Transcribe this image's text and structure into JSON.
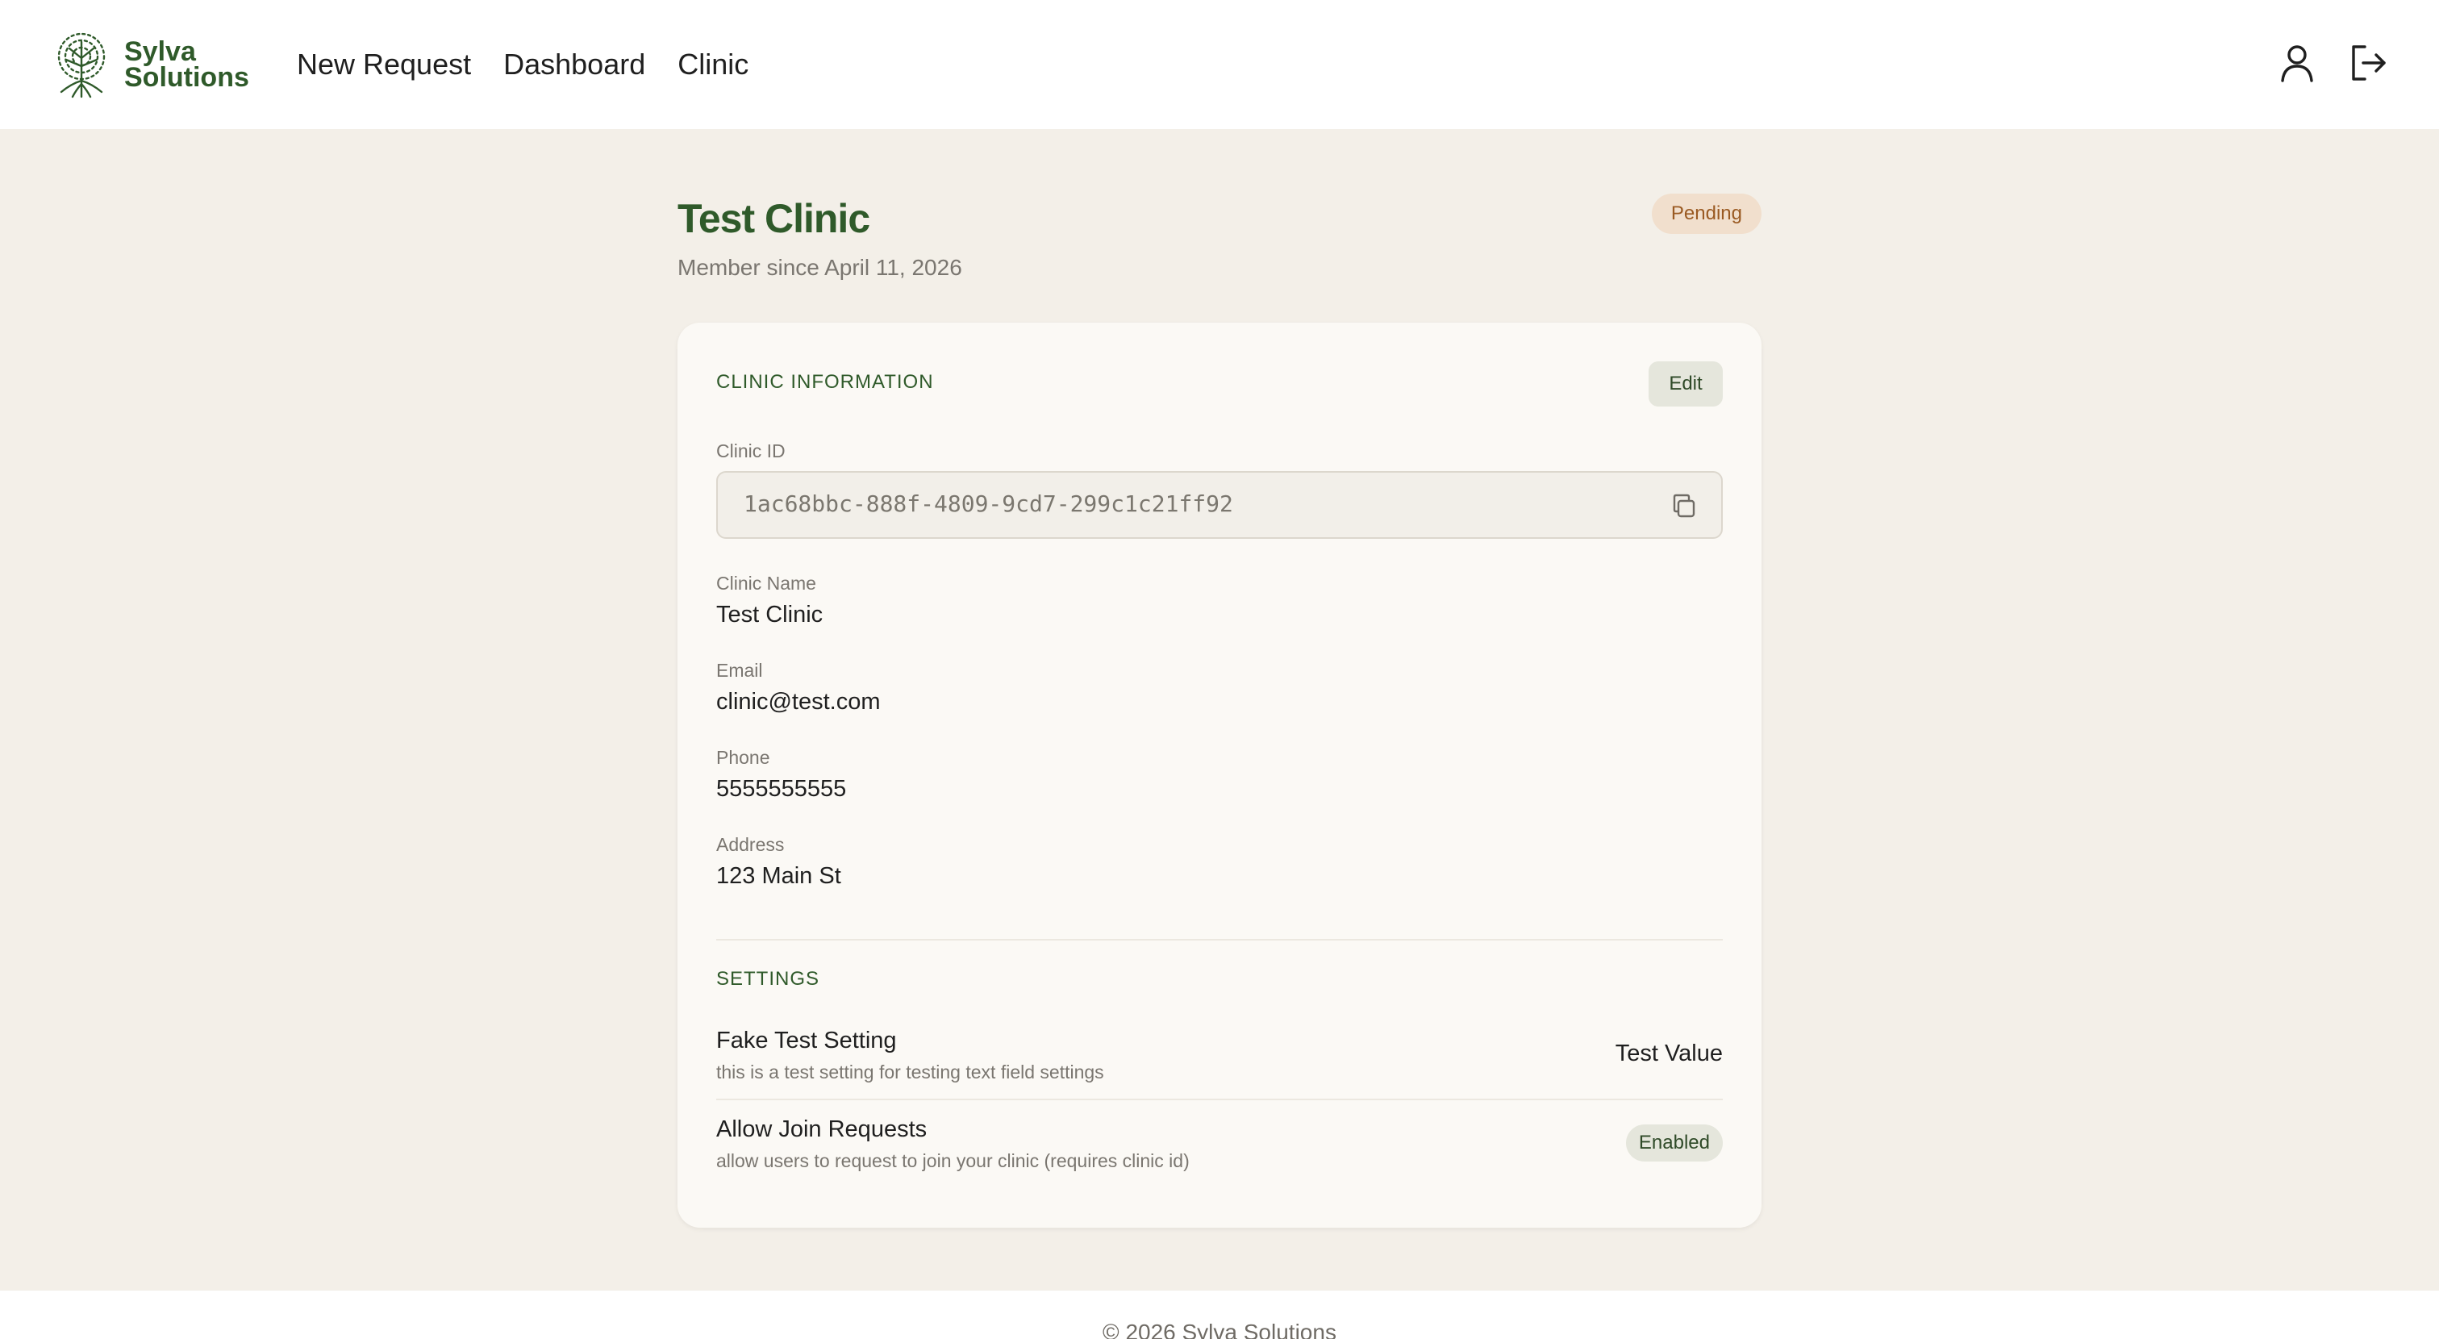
{
  "brand": {
    "line1": "Sylva",
    "line2": "Solutions",
    "color": "#2f5a2a"
  },
  "nav": {
    "items": [
      "New Request",
      "Dashboard",
      "Clinic"
    ]
  },
  "header_icons": {
    "profile": "user-icon",
    "logout": "logout-icon"
  },
  "page": {
    "title": "Test Clinic",
    "member_since": "Member since April 11, 2026",
    "status": "Pending"
  },
  "clinic_info": {
    "heading": "CLINIC INFORMATION",
    "edit_label": "Edit",
    "id_label": "Clinic ID",
    "id_value": "1ac68bbc-888f-4809-9cd7-299c1c21ff92",
    "fields": [
      {
        "label": "Clinic Name",
        "value": "Test Clinic"
      },
      {
        "label": "Email",
        "value": "clinic@test.com"
      },
      {
        "label": "Phone",
        "value": "5555555555"
      },
      {
        "label": "Address",
        "value": "123 Main St"
      }
    ]
  },
  "settings": {
    "heading": "SETTINGS",
    "items": [
      {
        "title": "Fake Test Setting",
        "description": "this is a test setting for testing text field settings",
        "value": "Test Value"
      },
      {
        "title": "Allow Join Requests",
        "description": "allow users to request to join your clinic (requires clinic id)",
        "value": "Enabled"
      }
    ]
  },
  "footer": {
    "text": "© 2026 Sylva Solutions"
  },
  "colors": {
    "accent": "#2f5a2a",
    "background": "#f3efe8",
    "pending_bg": "#f1dfcd",
    "pending_text": "#9a5a22"
  }
}
